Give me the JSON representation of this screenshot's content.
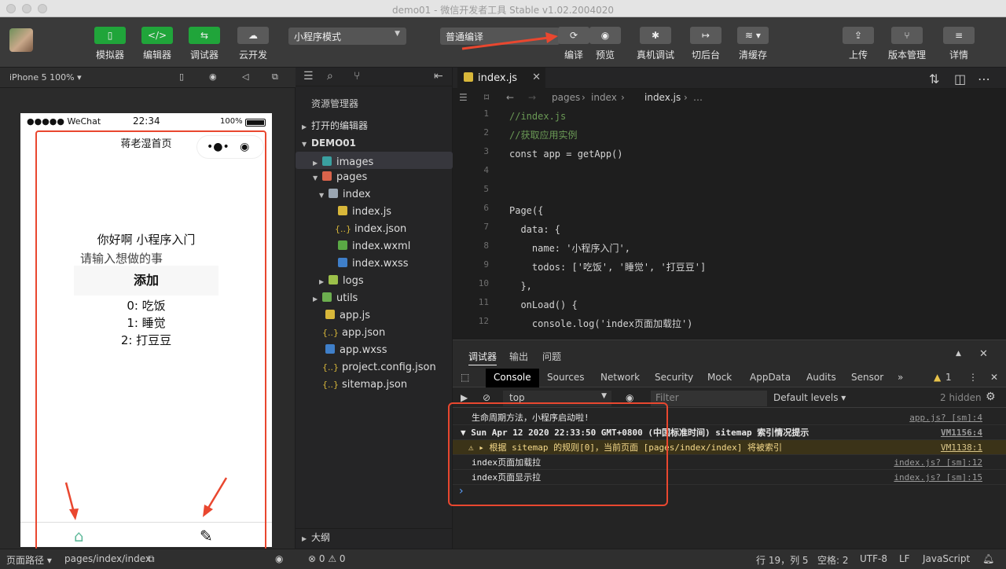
{
  "window": {
    "title": "demo01 - 微信开发者工具 Stable v1.02.2004020"
  },
  "toolbar": {
    "simulator": "模拟器",
    "editor": "编辑器",
    "debugger": "调试器",
    "cloud": "云开发",
    "mode": "小程序模式",
    "compile_mode": "普通编译",
    "compile": "编译",
    "preview": "预览",
    "remote_debug": "真机调试",
    "background": "切后台",
    "clear_cache": "清缓存",
    "upload": "上传",
    "version": "版本管理",
    "details": "详情"
  },
  "sim": {
    "device": "iPhone 5 100% ▾",
    "status_carrier": "●●●●● WeChat",
    "status_time": "22:34",
    "status_battery": "100%",
    "nav_title": "蒋老湿首页",
    "greeting": "你好啊 小程序入门",
    "input_placeholder": "请输入想做的事",
    "add_button": "添加",
    "todos": [
      "0: 吃饭",
      "1: 睡觉",
      "2: 打豆豆"
    ]
  },
  "explorer": {
    "title": "资源管理器",
    "open_editors": "打开的编辑器",
    "project": "DEMO01",
    "items": [
      "images",
      "pages",
      "index",
      "index.js",
      "index.json",
      "index.wxml",
      "index.wxss",
      "logs",
      "utils",
      "app.js",
      "app.json",
      "app.wxss",
      "project.config.json",
      "sitemap.json"
    ],
    "outline": "大纲"
  },
  "editor": {
    "tab": "index.js",
    "breadcrumb": [
      "pages",
      "index",
      "index.js",
      "…"
    ],
    "lines": [
      {
        "n": "1",
        "t": "//index.js",
        "c": "cm"
      },
      {
        "n": "2",
        "t": "//获取应用实例",
        "c": "cm"
      },
      {
        "n": "3",
        "t": "const app = getApp()",
        "c": "code"
      },
      {
        "n": "4",
        "t": "",
        "c": "code"
      },
      {
        "n": "5",
        "t": "",
        "c": "code"
      },
      {
        "n": "6",
        "t": "Page({",
        "c": "code"
      },
      {
        "n": "7",
        "t": "  data: {",
        "c": "code"
      },
      {
        "n": "8",
        "t": "    name: '小程序入门',",
        "c": "code"
      },
      {
        "n": "9",
        "t": "    todos: ['吃饭', '睡觉', '打豆豆']",
        "c": "code"
      },
      {
        "n": "10",
        "t": "  },",
        "c": "code"
      },
      {
        "n": "11",
        "t": "  onLoad() {",
        "c": "code"
      },
      {
        "n": "12",
        "t": "    console.log('index页面加载拉')",
        "c": "code"
      }
    ]
  },
  "devtools": {
    "panel_tabs": [
      "调试器",
      "输出",
      "问题"
    ],
    "tabs": [
      "Console",
      "Sources",
      "Network",
      "Security",
      "Mock",
      "AppData",
      "Audits",
      "Sensor",
      "»"
    ],
    "warn_count": "1",
    "context": "top",
    "filter_placeholder": "Filter",
    "levels": "Default levels ▾",
    "hidden": "2 hidden",
    "logs": [
      {
        "text": "生命周期方法，小程序启动啦!",
        "src": "app.js? [sm]:4"
      },
      {
        "text": "▼ Sun Apr 12 2020 22:33:50 GMT+0800 (中国标准时间) sitemap 索引情况提示",
        "src": "VM1156:4"
      },
      {
        "text": "⚠ ▸ 根据 sitemap 的规则[0]，当前页面 [pages/index/index] 将被索引",
        "src": "VM1138:1"
      },
      {
        "text": "index页面加载拉",
        "src": "index.js? [sm]:12"
      },
      {
        "text": "index页面显示拉",
        "src": "index.js? [sm]:15"
      }
    ],
    "prompt": "›"
  },
  "status": {
    "page_path_label": "页面路径 ▾",
    "page_path": "pages/index/index",
    "errors": "⊗ 0 ⚠ 0",
    "position": "行 19，列 5",
    "spaces": "空格: 2",
    "encoding": "UTF-8",
    "eol": "LF",
    "language": "JavaScript"
  }
}
